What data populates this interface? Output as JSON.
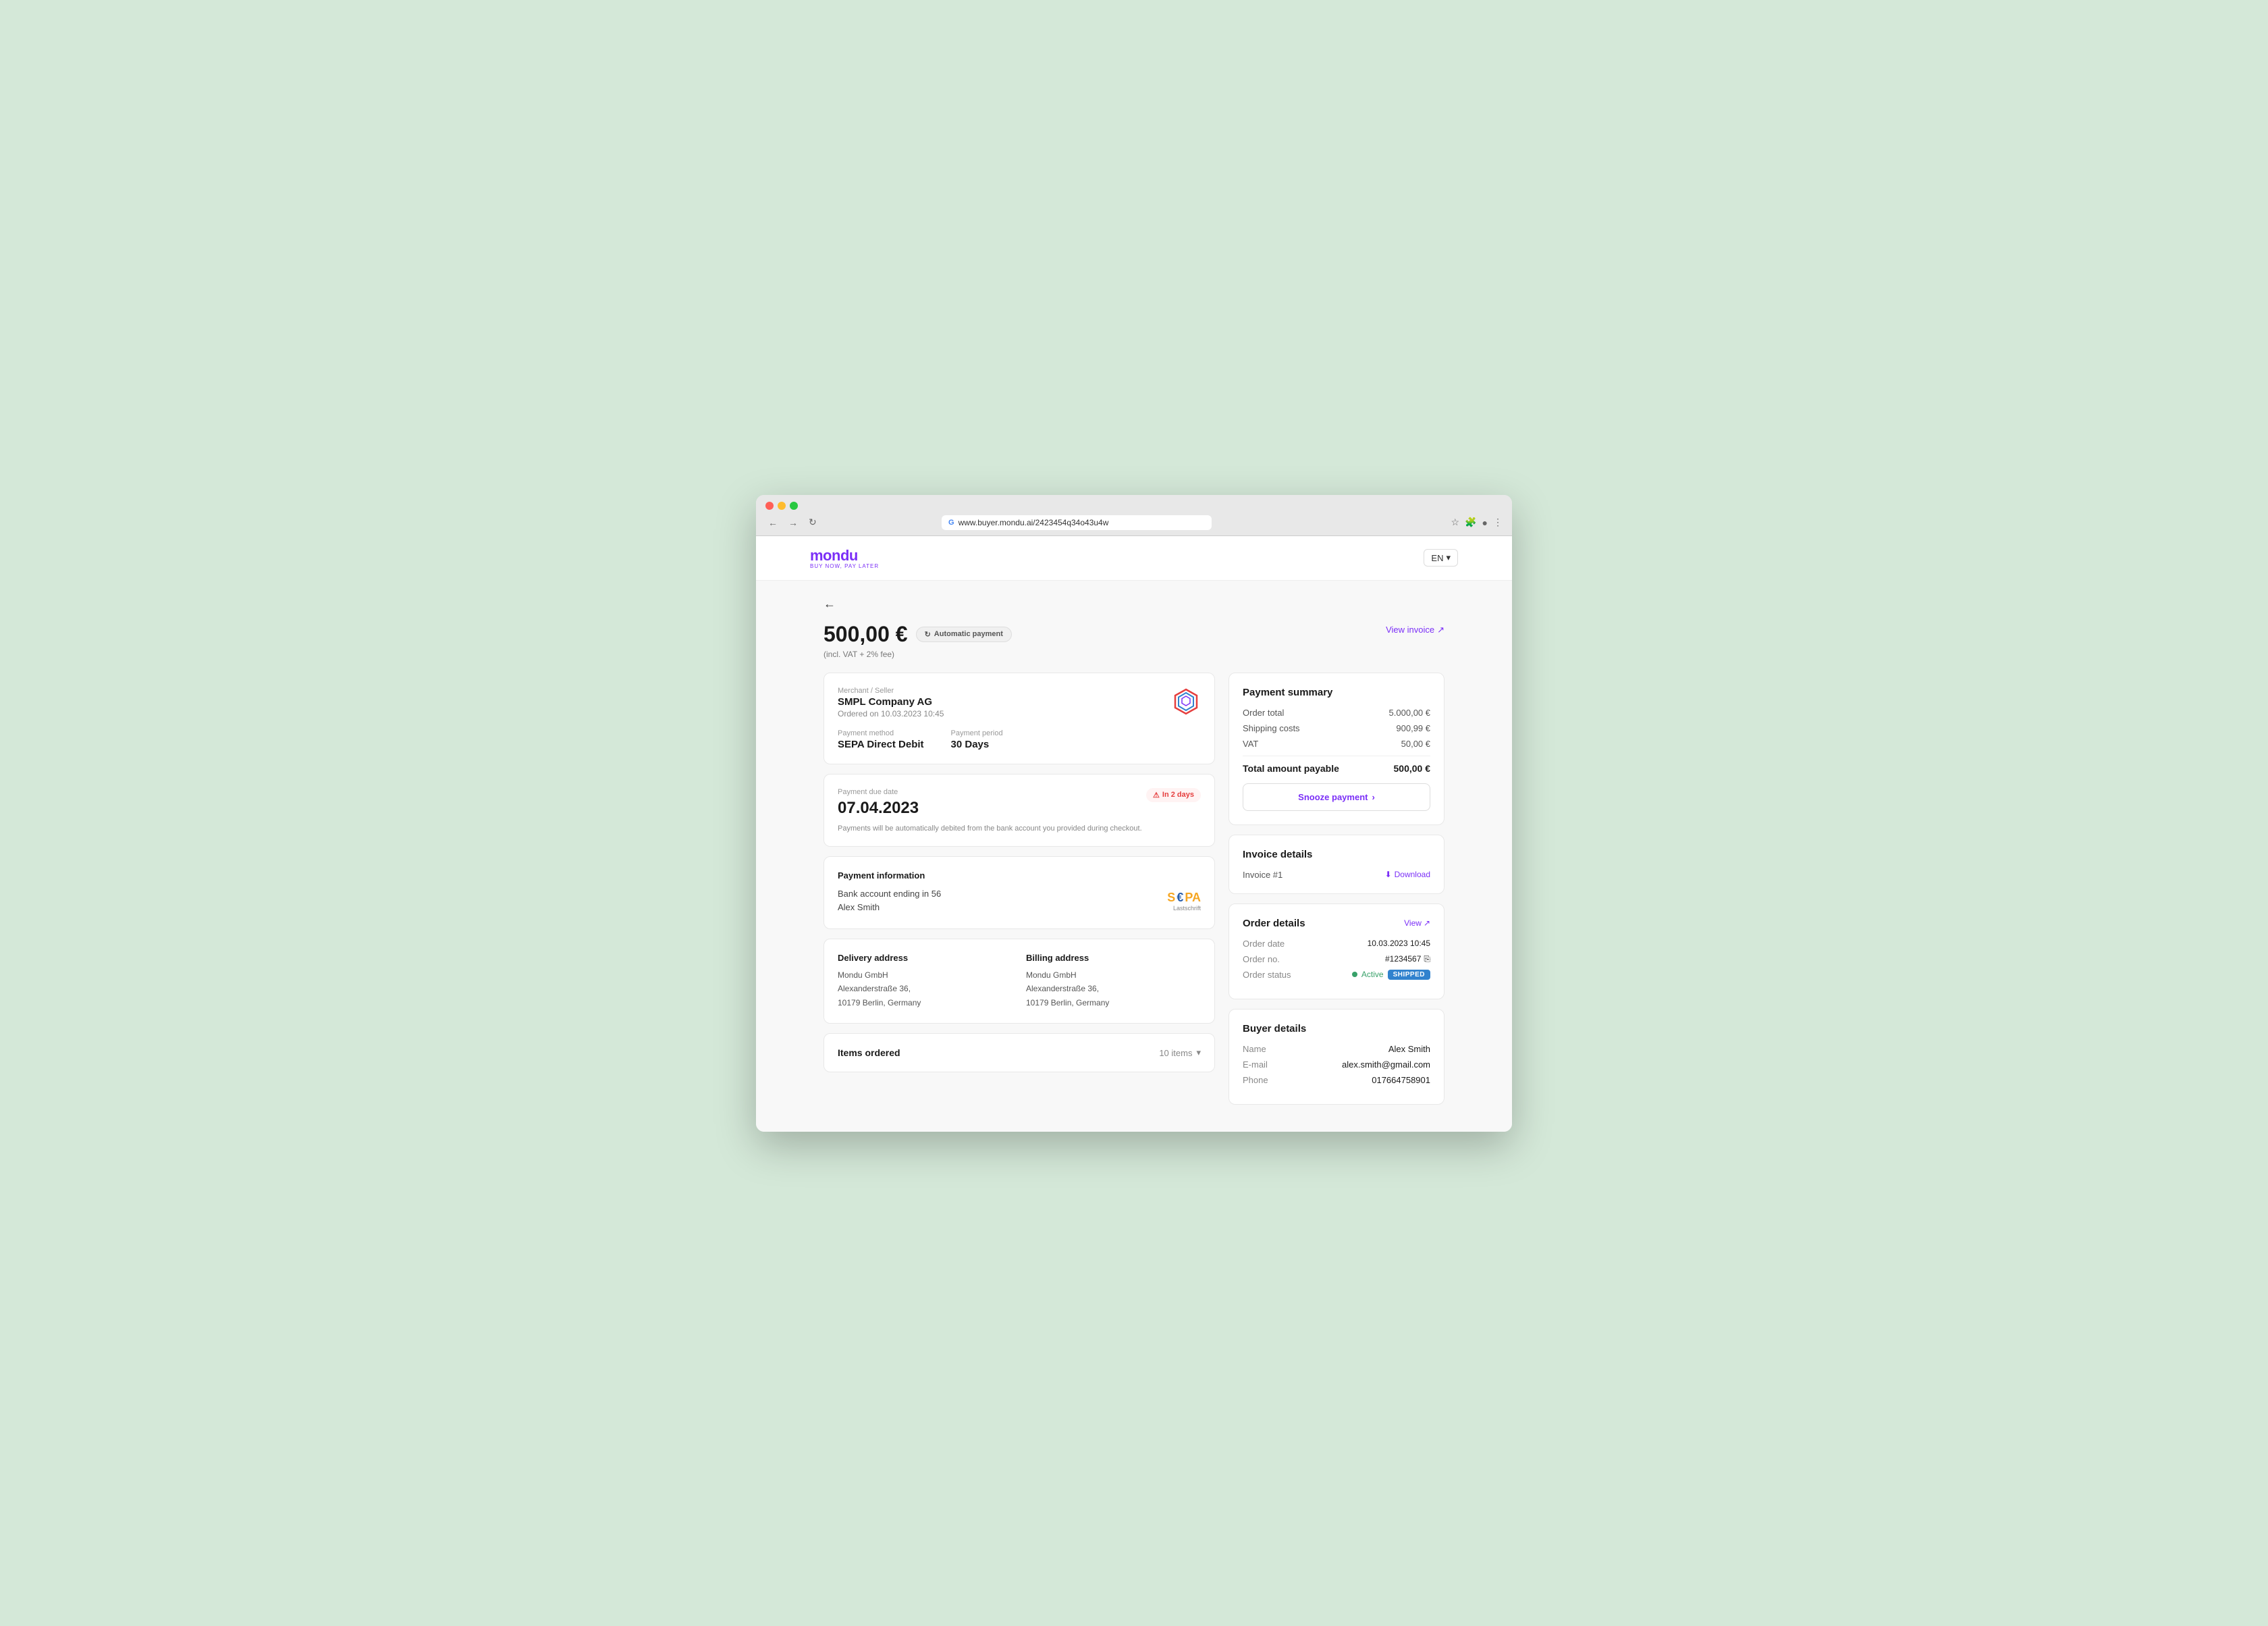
{
  "browser": {
    "url": "www.buyer.mondu.ai/2423454q34o43u4w",
    "tab_label": "+"
  },
  "header": {
    "logo_text": "mondu",
    "tagline": "BUY NOW, PAY LATER",
    "lang": "EN"
  },
  "page": {
    "back_label": "←",
    "amount": "500,00 €",
    "amount_note": "(incl. VAT + 2% fee)",
    "auto_payment_badge": "Automatic payment",
    "view_invoice": "View invoice"
  },
  "merchant": {
    "label": "Merchant / Seller",
    "name": "SMPL Company AG",
    "order_date": "Ordered on 10.03.2023 10:45",
    "payment_method_label": "Payment method",
    "payment_method": "SEPA Direct Debit",
    "payment_period_label": "Payment period",
    "payment_period": "30 Days"
  },
  "due": {
    "label": "Payment due date",
    "date": "07.04.2023",
    "badge": "In 2 days",
    "note": "Payments will be automatically debited from the bank account you provided during checkout."
  },
  "payment_info": {
    "title": "Payment information",
    "bank_line1": "Bank account ending in 56",
    "bank_line2": "Alex Smith",
    "sepa_text": "SEPA",
    "sepa_sub": "Lastschrift"
  },
  "addresses": {
    "delivery_label": "Delivery address",
    "delivery": [
      "Mondu GmbH",
      "Alexanderstraße 36,",
      "10179 Berlin, Germany"
    ],
    "billing_label": "Billing address",
    "billing": [
      "Mondu GmbH",
      "Alexanderstraße 36,",
      "10179 Berlin, Germany"
    ]
  },
  "items": {
    "label": "Items ordered",
    "count": "10 items"
  },
  "payment_summary": {
    "title": "Payment summary",
    "order_total_label": "Order total",
    "order_total": "5.000,00 €",
    "shipping_label": "Shipping costs",
    "shipping": "900,99 €",
    "vat_label": "VAT",
    "vat": "50,00 €",
    "total_label": "Total amount payable",
    "total": "500,00 €",
    "snooze_label": "Snooze payment"
  },
  "invoice_details": {
    "title": "Invoice details",
    "invoice_label": "Invoice #1",
    "download_label": "Download"
  },
  "order_details": {
    "title": "Order details",
    "view_label": "View",
    "order_date_label": "Order date",
    "order_date": "10.03.2023 10:45",
    "order_no_label": "Order no.",
    "order_no": "#1234567",
    "order_status_label": "Order status",
    "order_status_active": "Active",
    "order_status_shipped": "SHIPPED"
  },
  "buyer_details": {
    "title": "Buyer details",
    "name_label": "Name",
    "name": "Alex Smith",
    "email_label": "E-mail",
    "email": "alex.smith@gmail.com",
    "phone_label": "Phone",
    "phone": "017664758901"
  }
}
